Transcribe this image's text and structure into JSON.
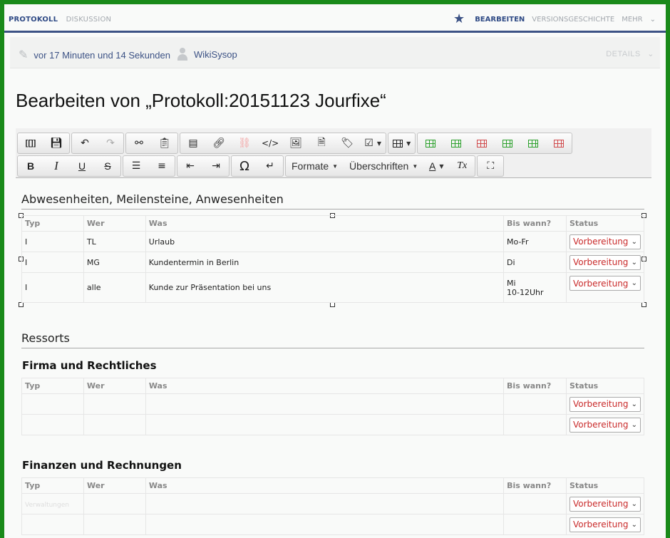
{
  "nav": {
    "tab_protokoll": "PROTOKOLL",
    "tab_diskussion": "DISKUSSION",
    "action_bearbeiten": "BEARBEITEN",
    "action_versionsgeschichte": "VERSIONSGESCHICHTE",
    "action_mehr": "MEHR"
  },
  "info": {
    "time_ago": "vor 17 Minuten und 14 Sekunden",
    "user": "WikiSysop",
    "details": "DETAILS"
  },
  "page_title": "Bearbeiten von „Protokoll:20151123 Jourfixe“",
  "toolbar": {
    "wikitext_label": "[[]]",
    "formate_label": "Formate",
    "ueberschriften_label": "Überschriften",
    "omega_label": "Ω",
    "textcolor_label": "A",
    "clearformat_label": "Tx"
  },
  "section1": {
    "heading": "Abwesenheiten, Meilensteine, Anwesenheiten",
    "columns": [
      "Typ",
      "Wer",
      "Was",
      "Bis wann?",
      "Status"
    ],
    "rows": [
      {
        "typ": "I",
        "wer": "TL",
        "was": "Urlaub",
        "bis": "Mo-Fr",
        "bis2": "",
        "status": "Vorbereitung"
      },
      {
        "typ": "I",
        "wer": "MG",
        "was": "Kundentermin in Berlin",
        "bis": "Di",
        "bis2": "",
        "status": "Vorbereitung"
      },
      {
        "typ": "I",
        "wer": "alle",
        "was": "Kunde zur Präsentation bei uns",
        "bis": "Mi",
        "bis2": "10-12Uhr",
        "status": "Vorbereitung"
      }
    ]
  },
  "section2": {
    "heading": "Ressorts"
  },
  "section3": {
    "heading": "Firma und Rechtliches",
    "columns": [
      "Typ",
      "Wer",
      "Was",
      "Bis wann?",
      "Status"
    ],
    "rows": [
      {
        "status": "Vorbereitung"
      },
      {
        "status": "Vorbereitung"
      }
    ]
  },
  "section4": {
    "heading": "Finanzen und Rechnungen",
    "columns": [
      "Typ",
      "Wer",
      "Was",
      "Bis wann?",
      "Status"
    ],
    "rows": [
      {
        "status": "Vorbereitung",
        "ghost": "Verwaltungen"
      },
      {
        "status": "Vorbereitung",
        "ghost": ""
      }
    ]
  }
}
